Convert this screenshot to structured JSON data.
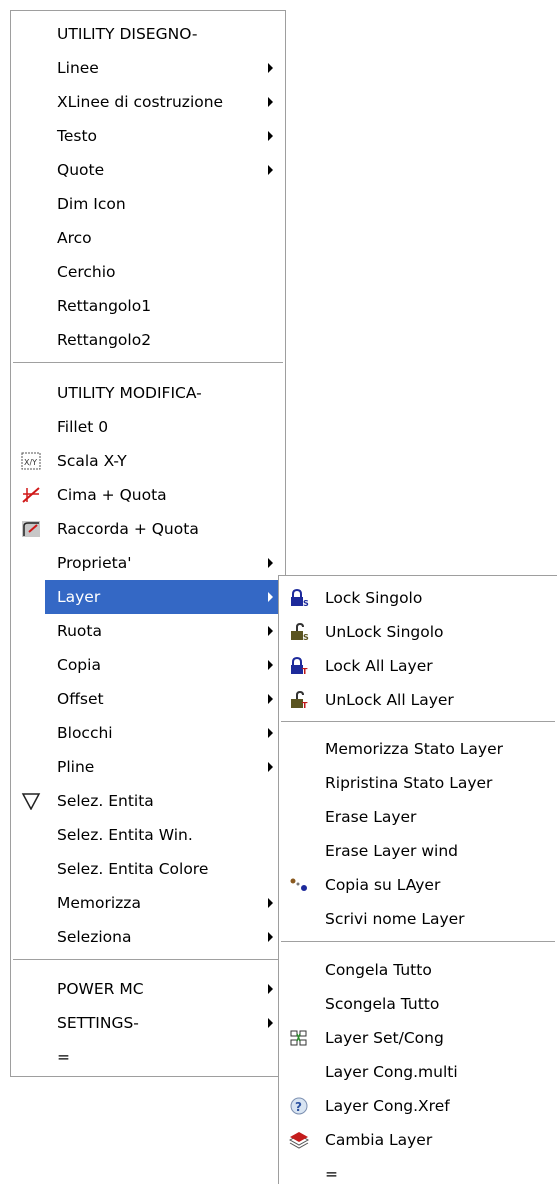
{
  "main_menu": {
    "items": [
      {
        "label": "UTILITY DISEGNO-"
      },
      {
        "label": "Linee"
      },
      {
        "label": "XLinee di costruzione"
      },
      {
        "label": "Testo"
      },
      {
        "label": "Quote"
      },
      {
        "label": "Dim Icon"
      },
      {
        "label": "Arco"
      },
      {
        "label": "Cerchio"
      },
      {
        "label": "Rettangolo1"
      },
      {
        "label": "Rettangolo2"
      },
      {
        "label": "UTILITY MODIFICA-"
      },
      {
        "label": "Fillet 0"
      },
      {
        "label": "Scala X-Y",
        "icon": "scale-xy-icon"
      },
      {
        "label": "Cima + Quota",
        "icon": "trim-dimension-icon"
      },
      {
        "label": "Raccorda + Quota",
        "icon": "fillet-dimension-icon"
      },
      {
        "label": "Proprieta'"
      },
      {
        "label": "Layer"
      },
      {
        "label": "Ruota"
      },
      {
        "label": "Copia"
      },
      {
        "label": "Offset"
      },
      {
        "label": "Blocchi"
      },
      {
        "label": "Pline"
      },
      {
        "label": "Selez. Entita",
        "icon": "triangle-select-icon"
      },
      {
        "label": "Selez. Entita Win."
      },
      {
        "label": "Selez. Entita Colore"
      },
      {
        "label": "Memorizza"
      },
      {
        "label": "Seleziona"
      },
      {
        "label": "POWER MC"
      },
      {
        "label": "SETTINGS-"
      },
      {
        "label": "="
      }
    ]
  },
  "layer_submenu": {
    "items": [
      {
        "label": "Lock Singolo",
        "icon": "lock-single-icon"
      },
      {
        "label": "UnLock Singolo",
        "icon": "unlock-single-icon"
      },
      {
        "label": "Lock All Layer",
        "icon": "lock-all-icon"
      },
      {
        "label": "UnLock All Layer",
        "icon": "unlock-all-icon"
      },
      {
        "label": "Memorizza Stato Layer"
      },
      {
        "label": "Ripristina Stato Layer"
      },
      {
        "label": "Erase Layer"
      },
      {
        "label": "Erase Layer wind"
      },
      {
        "label": "Copia su LAyer",
        "icon": "copy-to-layer-icon"
      },
      {
        "label": "Scrivi nome Layer"
      },
      {
        "label": "Congela Tutto"
      },
      {
        "label": "Scongela Tutto"
      },
      {
        "label": "Layer Set/Cong",
        "icon": "layer-set-freeze-icon"
      },
      {
        "label": "Layer Cong.multi"
      },
      {
        "label": "Layer Cong.Xref",
        "icon": "help-xref-icon"
      },
      {
        "label": "Cambia Layer",
        "icon": "change-layer-icon"
      },
      {
        "label": "="
      }
    ]
  },
  "colors": {
    "highlight": "#3468c5",
    "border": "#9e9e9e"
  }
}
